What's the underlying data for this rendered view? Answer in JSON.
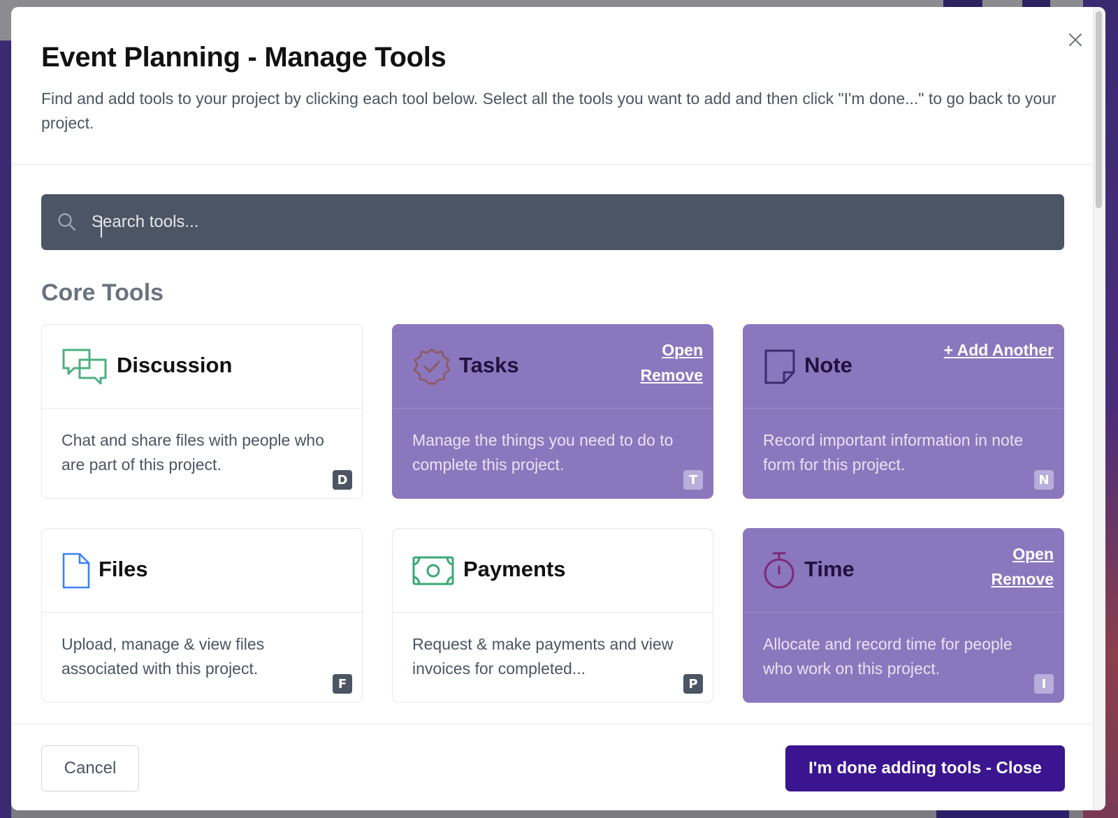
{
  "modal": {
    "title": "Event Planning - Manage Tools",
    "subtitle": "Find and add tools to your project by clicking each tool below. Select all the tools you want to add and then click \"I'm done...\" to go back to your project."
  },
  "search": {
    "placeholder": "Search tools..."
  },
  "section": {
    "title": "Core Tools"
  },
  "tools": [
    {
      "name": "Discussion",
      "icon": "chat-bubbles-icon",
      "description": "Chat and share files with people who are part of this project.",
      "shortcut": "D",
      "active": false,
      "links": []
    },
    {
      "name": "Tasks",
      "icon": "check-badge-icon",
      "description": "Manage the things you need to do to complete this project.",
      "shortcut": "T",
      "active": true,
      "links": [
        "Open",
        "Remove"
      ]
    },
    {
      "name": "Note",
      "icon": "sticky-note-icon",
      "description": "Record important information in note form for this project.",
      "shortcut": "N",
      "active": true,
      "links": [
        "+ Add Another"
      ]
    },
    {
      "name": "Files",
      "icon": "document-icon",
      "description": "Upload, manage & view files associated with this project.",
      "shortcut": "F",
      "active": false,
      "links": []
    },
    {
      "name": "Payments",
      "icon": "banknote-icon",
      "description": "Request & make payments and view invoices for completed...",
      "shortcut": "P",
      "active": false,
      "links": []
    },
    {
      "name": "Time",
      "icon": "stopwatch-icon",
      "description": "Allocate and record time for people who work on this project.",
      "shortcut": "I",
      "active": true,
      "links": [
        "Open",
        "Remove"
      ]
    }
  ],
  "footer": {
    "cancel_label": "Cancel",
    "done_label": "I'm done adding tools - Close"
  },
  "colors": {
    "active_card": "#8b77bd",
    "primary_button": "#3b1590",
    "search_bg": "#4b5563",
    "discussion_icon": "#4caf7f",
    "tasks_icon": "#8a5a63",
    "note_icon": "#3d2b6e",
    "files_icon": "#3b82f6",
    "payments_icon": "#3aa876",
    "time_icon": "#7a2a7a"
  }
}
